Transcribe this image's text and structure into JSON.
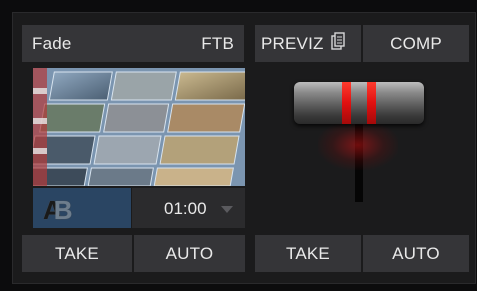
{
  "transition": {
    "fade_label": "Fade",
    "ftb_label": "FTB",
    "duration": "01:00",
    "take_label": "TAKE",
    "auto_label": "AUTO"
  },
  "preview": {
    "previz_label": "PREVIZ",
    "comp_label": "COMP",
    "take_label": "TAKE",
    "auto_label": "AUTO"
  },
  "tbar": {
    "position_fraction": 0,
    "accent": "#e01010"
  },
  "icons": {
    "previz": "copy-layers-icon",
    "transition_type": "ab-transition-icon",
    "duration_dropdown": "chevron-down-icon"
  },
  "colors": {
    "background": "#0c0c0d",
    "panel": "#1b1b1c",
    "button": "#353538",
    "selected_tile": "#2a4563",
    "tbar_red": "#e01010"
  }
}
